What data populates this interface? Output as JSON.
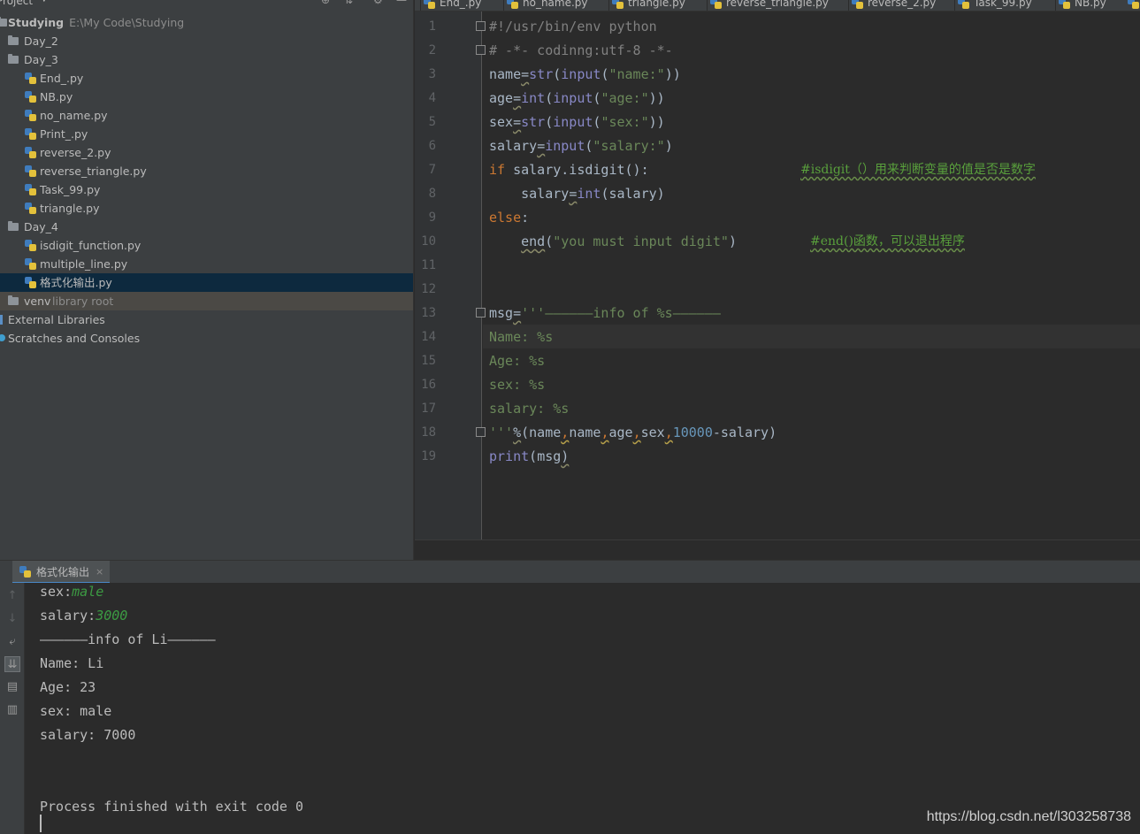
{
  "project": {
    "title": "Project",
    "root": {
      "name": "Studying",
      "path": "E:\\My Code\\Studying"
    },
    "nodes": [
      {
        "label": "Day_2",
        "type": "folder",
        "depth": 1
      },
      {
        "label": "Day_3",
        "type": "folder",
        "depth": 1
      },
      {
        "label": "End_.py",
        "type": "py",
        "depth": 2
      },
      {
        "label": "NB.py",
        "type": "py",
        "depth": 2
      },
      {
        "label": "no_name.py",
        "type": "py",
        "depth": 2
      },
      {
        "label": "Print_.py",
        "type": "py",
        "depth": 2
      },
      {
        "label": "reverse_2.py",
        "type": "py",
        "depth": 2
      },
      {
        "label": "reverse_triangle.py",
        "type": "py",
        "depth": 2
      },
      {
        "label": "Task_99.py",
        "type": "py",
        "depth": 2
      },
      {
        "label": "triangle.py",
        "type": "py",
        "depth": 2
      },
      {
        "label": "Day_4",
        "type": "folder",
        "depth": 1
      },
      {
        "label": "isdigit_function.py",
        "type": "py",
        "depth": 2
      },
      {
        "label": "multiple_line.py",
        "type": "py",
        "depth": 2
      },
      {
        "label": "格式化输出.py",
        "type": "py",
        "depth": 2,
        "selected": true
      },
      {
        "label": "venv",
        "sub": "library root",
        "type": "folder",
        "depth": 1,
        "highlight": true
      },
      {
        "label": "External Libraries",
        "type": "lib",
        "depth": 0
      },
      {
        "label": "Scratches and Consoles",
        "type": "scratch",
        "depth": 0
      }
    ]
  },
  "tabs": [
    "End_.py",
    "no_name.py",
    "triangle.py",
    "reverse_triangle.py",
    "reverse_2.py",
    "Task_99.py",
    "NB.py"
  ],
  "editor": {
    "line_numbers": [
      "1",
      "2",
      "3",
      "4",
      "5",
      "6",
      "7",
      "8",
      "9",
      "10",
      "11",
      "12",
      "13",
      "14",
      "15",
      "16",
      "17",
      "18",
      "19"
    ],
    "t": {
      "l1": "#!/usr/bin/env python",
      "l2": "# -*- codinng:utf-8 -*-",
      "name": "name",
      "eq": "=",
      "str": "str",
      "input": "input",
      "int": "int",
      "age": "age",
      "sex": "sex",
      "salary": "salary",
      "msg": "msg",
      "print": "print",
      "lp": "(",
      "rp": ")",
      "rpp": "))",
      "q_name": "\"name:\"",
      "q_age": "\"age:\"",
      "q_sex": "\"sex:\"",
      "q_salary": "\"salary:\"",
      "if": "if",
      "else": "else",
      "colon": ":",
      "isdigit": ".isdigit():",
      "indent": "    ",
      "end": "end",
      "q_digit": "\"you must input digit\"",
      "c7": "#isdigit（）用来判断变量的值是否是数字",
      "c10": "#end()函数，可以退出程序",
      "l13s": "'''——————info of %s——————",
      "l14": "Name: %s",
      "l15": "Age: %s",
      "l16": "sex: %s",
      "l17": "salary: %s",
      "l18q": "'''",
      "l18p": "%",
      "comma": ",",
      "num": "10000",
      "minus": "-"
    }
  },
  "run": {
    "tab_label": "格式化输出",
    "close": "×",
    "sex_prompt": "sex:",
    "sex_input": "male",
    "salary_prompt": "salary:",
    "salary_input": "3000",
    "output": [
      "——————info of Li——————",
      "Name: Li",
      "Age: 23",
      "sex: male",
      "salary: 7000"
    ],
    "finished": "Process finished with exit code 0"
  },
  "watermark": "https://blog.csdn.net/l303258738"
}
